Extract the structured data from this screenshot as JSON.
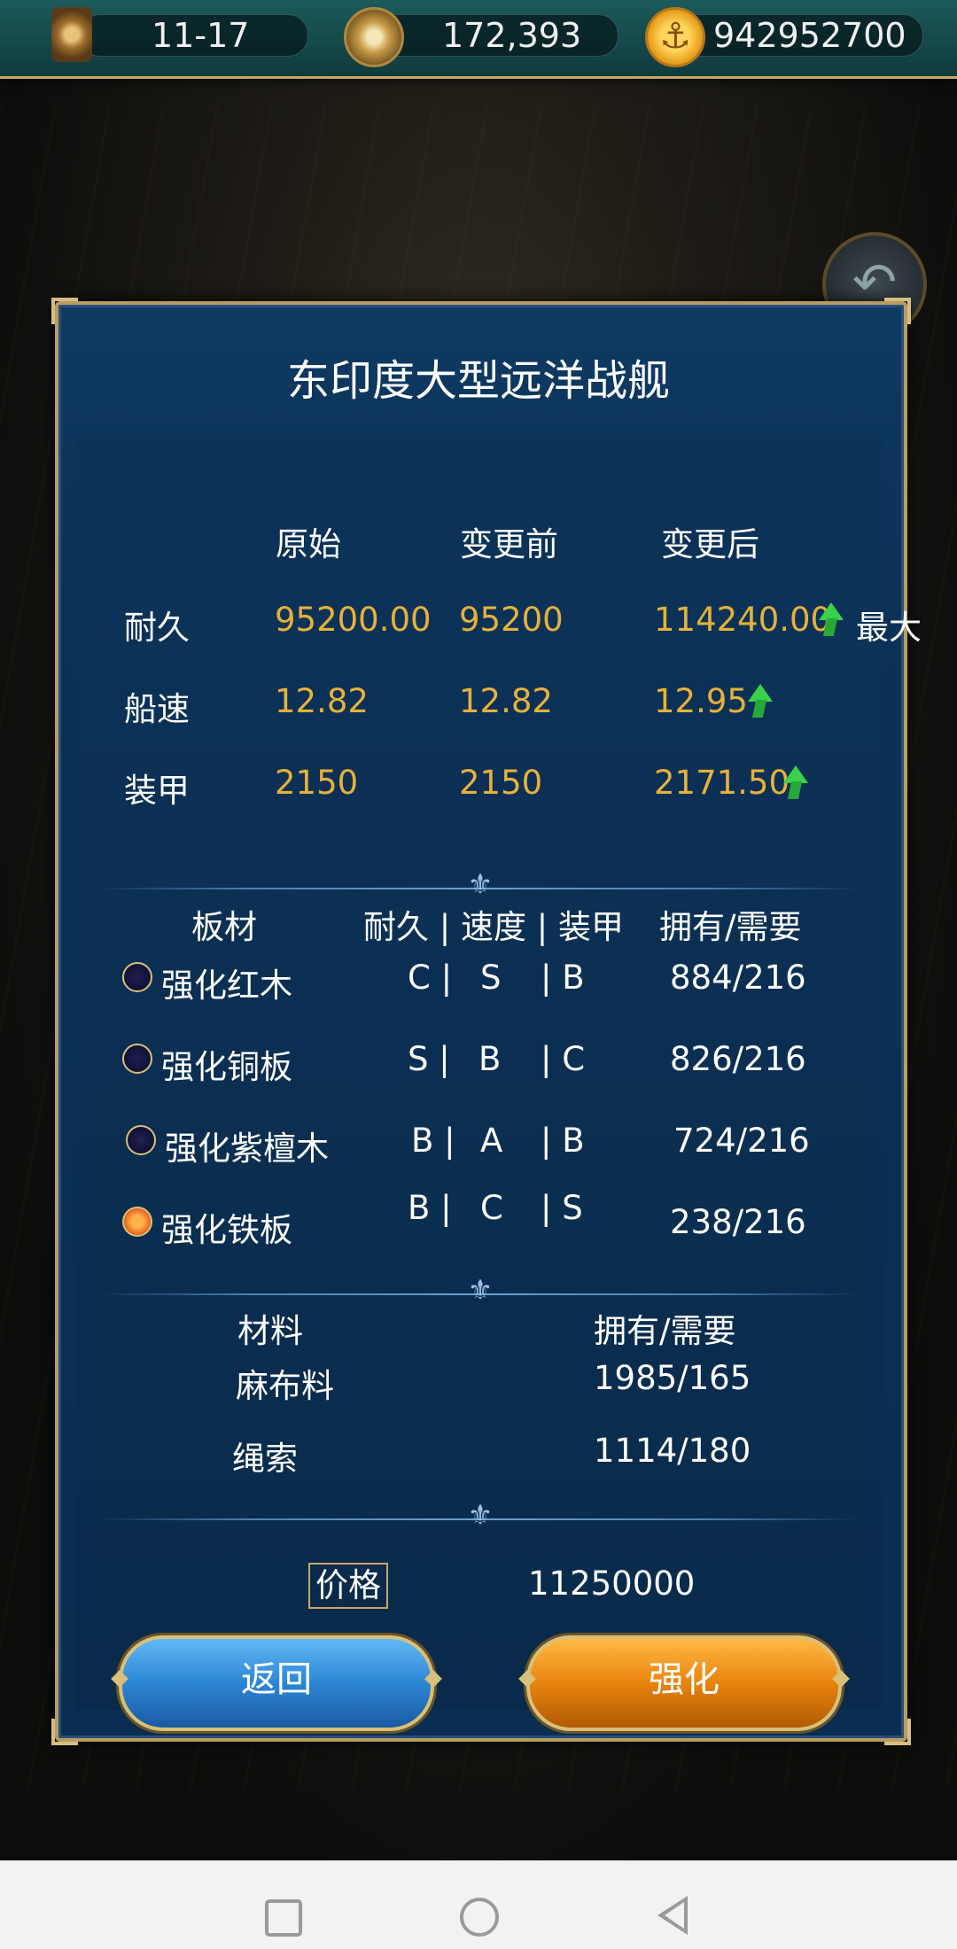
{
  "topbar": {
    "date": "11-17",
    "compass_value": "172,393",
    "gold": "942952700",
    "icons": [
      "hourglass-icon",
      "compass-icon",
      "anchor-coin-icon"
    ]
  },
  "dialog": {
    "title": "东印度大型远洋战舰",
    "stats_headers": [
      "原始",
      "变更前",
      "变更后"
    ],
    "stats": [
      {
        "label": "耐久",
        "original": "95200.00",
        "before": "95200",
        "after": "114240.00",
        "note": "最大"
      },
      {
        "label": "船速",
        "original": "12.82",
        "before": "12.82",
        "after": "12.95",
        "note": ""
      },
      {
        "label": "装甲",
        "original": "2150",
        "before": "2150",
        "after": "2171.50",
        "note": ""
      }
    ],
    "plank_headers": {
      "name": "板材",
      "grades": "耐久 | 速度 | 装甲",
      "owned": "拥有/需要"
    },
    "planks": [
      {
        "name": "强化红木",
        "d": "C |",
        "s": "S",
        "a": "| B",
        "owned": "884/216",
        "selected": false
      },
      {
        "name": "强化铜板",
        "d": "S |",
        "s": "B",
        "a": "| C",
        "owned": "826/216",
        "selected": false
      },
      {
        "name": "强化紫檀木",
        "d": "B |",
        "s": "A",
        "a": "| B",
        "owned": "724/216",
        "selected": false
      },
      {
        "name": "强化铁板",
        "d": "B |",
        "s": "C",
        "a": "| S",
        "owned": "238/216",
        "selected": true
      }
    ],
    "material_headers": {
      "name": "材料",
      "owned": "拥有/需要"
    },
    "materials": [
      {
        "name": "麻布料",
        "owned": "1985/165"
      },
      {
        "name": "绳索",
        "owned": "1114/180"
      }
    ],
    "price_label": "价格",
    "price": "11250000",
    "back_button": "返回",
    "enhance_button": "强化"
  },
  "colors": {
    "value": "#e6b13a",
    "up_arrow": "#39d24a",
    "panel": "#0b3157",
    "back_btn": "#2d86d3",
    "enhance_btn": "#e8840c"
  }
}
